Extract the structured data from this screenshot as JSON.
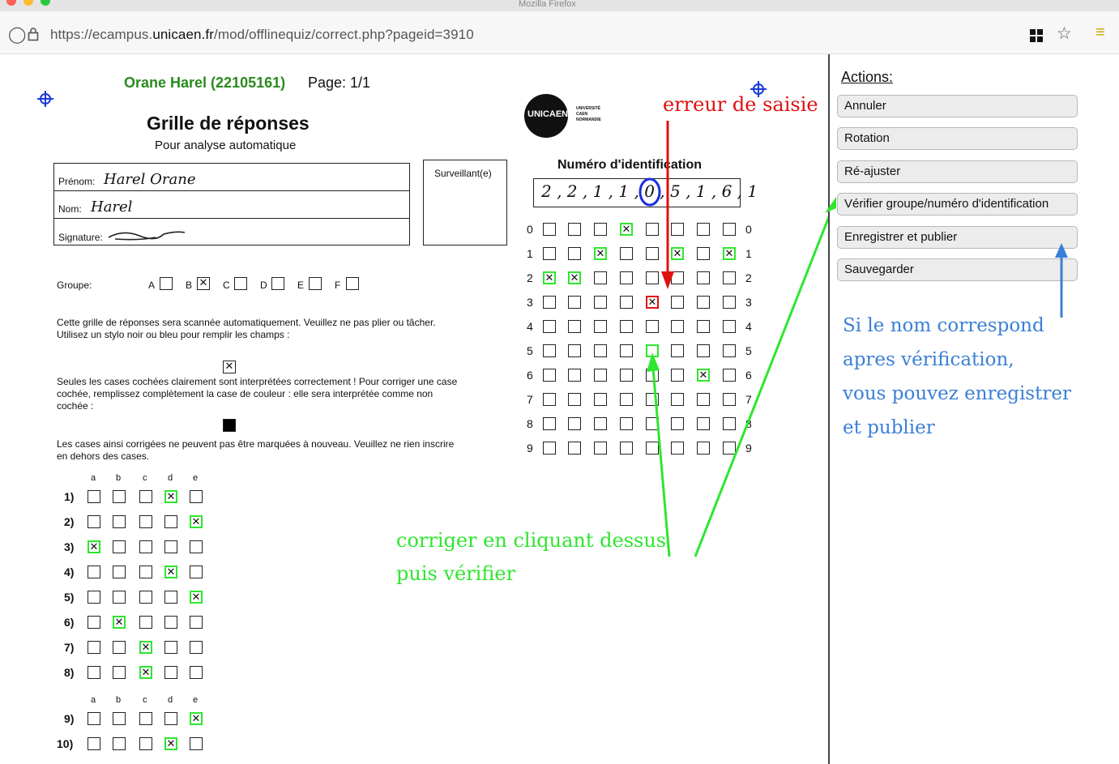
{
  "browser": {
    "window_title": "Mozilla Firefox",
    "url_prefix": "https://ecampus.",
    "url_domain": "unicaen.fr",
    "url_path": "/mod/offlinequiz/correct.php?pageid=3910"
  },
  "sheet": {
    "student": "Orane Harel (22105161)",
    "page": "Page: 1/1",
    "title": "Grille de réponses",
    "subtitle": "Pour analyse automatique",
    "logo_text": "UNICAEN",
    "logo_sub": [
      "UNIVERSITÉ",
      "CAEN",
      "NORMANDIE"
    ],
    "prenom_label": "Prénom:",
    "prenom_value": "Harel Orane",
    "nom_label": "Nom:",
    "nom_value": "Harel",
    "signature_label": "Signature:",
    "surveillant_label": "Surveillant(e)",
    "id_title": "Numéro d'identification",
    "id_written": "2 , 2 , 1 , 1 , 0 , 5 , 1 , 6 , 1",
    "groupe_label": "Groupe:",
    "groups": [
      "A",
      "B",
      "C",
      "D",
      "E",
      "F"
    ],
    "groupe_checked": "B",
    "instr1": "Cette grille de réponses sera scannée automatiquement. Veuillez ne pas plier ou tâcher.",
    "instr2": "Utilisez un stylo noir ou bleu pour remplir les champs :",
    "instr3": "Seules les cases cochées clairement sont interprétées correctement ! Pour corriger une case",
    "instr4": "cochée, remplissez complètement la case de couleur : elle sera interprétée comme non",
    "instr5": "cochée :",
    "instr6": "Les cases ainsi corrigées ne peuvent pas être marquées à nouveau. Veuillez ne rien inscrire",
    "instr7": "en dehors des cases.",
    "answer_cols": [
      "a",
      "b",
      "c",
      "d",
      "e"
    ],
    "answers": [
      {
        "label": "1)",
        "checked": "d"
      },
      {
        "label": "2)",
        "checked": "e"
      },
      {
        "label": "3)",
        "checked": "a"
      },
      {
        "label": "4)",
        "checked": "d"
      },
      {
        "label": "5)",
        "checked": "e"
      },
      {
        "label": "6)",
        "checked": "b"
      },
      {
        "label": "7)",
        "checked": "c"
      },
      {
        "label": "8)",
        "checked": "c"
      },
      {
        "label": "9)",
        "checked": "e"
      },
      {
        "label": "10)",
        "checked": "d"
      }
    ],
    "id_digits": [
      "0",
      "1",
      "2",
      "3",
      "4",
      "5",
      "6",
      "7",
      "8",
      "9"
    ],
    "id_marks": [
      "2",
      "2",
      "1",
      "0",
      "3",
      "1",
      "6",
      "1"
    ]
  },
  "annotations": {
    "error_label": "erreur de saisie",
    "fix_line1": "corriger en cliquant dessus",
    "fix_line2": "puis vérifier",
    "publish_line1": "Si le nom correspond",
    "publish_line2": "apres vérification,",
    "publish_line3": "vous pouvez enregistrer",
    "publish_line4": "et publier",
    "colors": {
      "red": "#e01010",
      "green": "#2ee62e",
      "blue": "#3a7fd6"
    }
  },
  "actions": {
    "title": "Actions:",
    "buttons": [
      "Annuler",
      "Rotation",
      "Ré-ajuster",
      "Vérifier groupe/numéro d'identification",
      "Enregistrer et publier",
      "Sauvegarder"
    ]
  }
}
